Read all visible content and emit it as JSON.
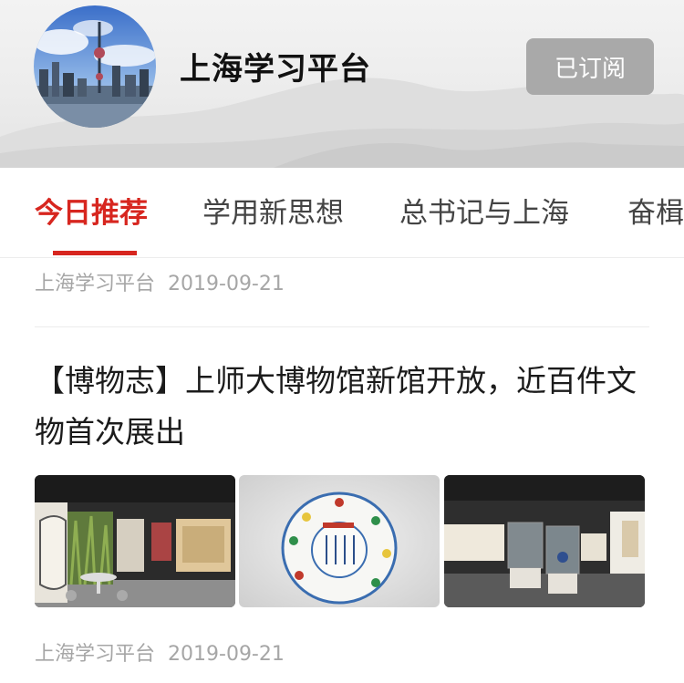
{
  "header": {
    "channel_name": "上海学习平台",
    "subscribe_label": "已订阅"
  },
  "tabs": [
    {
      "label": "今日推荐",
      "active": true
    },
    {
      "label": "学用新思想",
      "active": false
    },
    {
      "label": "总书记与上海",
      "active": false
    },
    {
      "label": "奋楫",
      "active": false
    }
  ],
  "feed": {
    "items": [
      {
        "source": "上海学习平台",
        "date": "2019-09-21"
      },
      {
        "title": "【博物志】上师大博物馆新馆开放，近百件文物首次展出",
        "source": "上海学习平台",
        "date": "2019-09-21",
        "images": [
          "museum-hall-image",
          "porcelain-bowl-image",
          "exhibition-room-image"
        ]
      }
    ]
  },
  "colors": {
    "accent": "#d7261f",
    "subscribe_bg": "#a9a9a9",
    "meta_text": "#a6a6a6"
  }
}
